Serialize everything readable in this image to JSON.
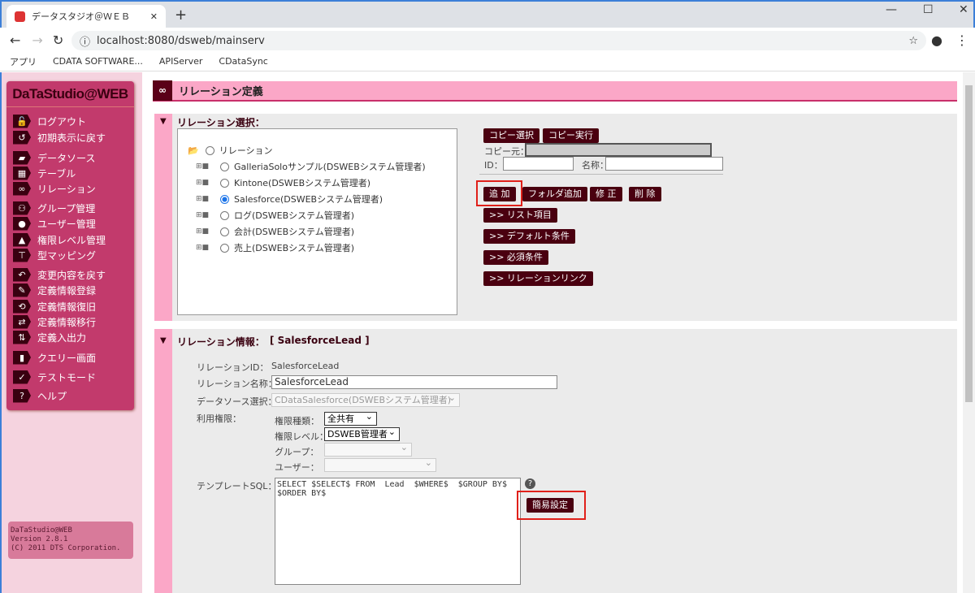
{
  "browser": {
    "tab_title": "データスタジオ＠ＷＥＢ",
    "url": "localhost:8080/dsweb/mainserv",
    "bookmarks": [
      "アプリ",
      "CDATA SOFTWARE...",
      "APIServer",
      "CDataSync"
    ]
  },
  "sidebar": {
    "logo": "DaTaStudio@WEB",
    "items": [
      {
        "label": "ログアウト",
        "icon": "lock-icon"
      },
      {
        "label": "初期表示に戻す",
        "icon": "reset-icon"
      },
      {
        "label": "データソース",
        "icon": "folder-open-icon"
      },
      {
        "label": "テーブル",
        "icon": "table-icon"
      },
      {
        "label": "リレーション",
        "icon": "link-icon"
      },
      {
        "label": "グループ管理",
        "icon": "group-icon"
      },
      {
        "label": "ユーザー管理",
        "icon": "user-icon"
      },
      {
        "label": "権限レベル管理",
        "icon": "pyramid-icon"
      },
      {
        "label": "型マッピング",
        "icon": "mapping-icon"
      },
      {
        "label": "変更内容を戻す",
        "icon": "undo-doc-icon"
      },
      {
        "label": "定義情報登録",
        "icon": "edit-doc-icon"
      },
      {
        "label": "定義情報復旧",
        "icon": "restore-doc-icon"
      },
      {
        "label": "定義情報移行",
        "icon": "migrate-doc-icon"
      },
      {
        "label": "定義入出力",
        "icon": "import-export-icon"
      },
      {
        "label": "クエリー画面",
        "icon": "chart-icon"
      },
      {
        "label": "テストモード",
        "icon": "check-icon"
      },
      {
        "label": "ヘルプ",
        "icon": "help-icon"
      }
    ],
    "version": [
      "DaTaStudio@WEB",
      "Version 2.8.1",
      "(C) 2011 DTS Corporation."
    ]
  },
  "header": {
    "title": "リレーション定義"
  },
  "select_section": {
    "title": "リレーション選択：",
    "root": "リレーション",
    "items": [
      "GalleriaSoloサンプル(DSWEBシステム管理者)",
      "Kintone(DSWEBシステム管理者)",
      "Salesforce(DSWEBシステム管理者)",
      "ログ(DSWEBシステム管理者)",
      "会計(DSWEBシステム管理者)",
      "売上(DSWEBシステム管理者)"
    ],
    "selected": 2,
    "copy_select": "コピー選択",
    "copy_exec": "コピー実行",
    "copy_src_label": "コピー元：",
    "id_label": "ID：",
    "name_label": "名称：",
    "add": "追 加",
    "add_folder": "フォルダ追加",
    "edit": "修 正",
    "delete": "削 除",
    "list_items": ">> リスト項目",
    "default_cond": ">> デフォルト条件",
    "required_cond": ">> 必須条件",
    "relation_link": ">> リレーションリンク"
  },
  "info_section": {
    "title": "リレーション情報：",
    "name_bracket": "[ SalesforceLead ]",
    "id_label": "リレーションID：",
    "id_value": "SalesforceLead",
    "name_label": "リレーション名称：",
    "name_value": "SalesforceLead",
    "ds_label": "データソース選択：",
    "ds_value": "CDataSalesforce(DSWEBシステム管理者)",
    "perm_label": "利用権限：",
    "perm_type_label": "権限種類：",
    "perm_type_value": "全共有",
    "perm_level_label": "権限レベル：",
    "perm_level_value": "DSWEB管理者",
    "group_label": "グループ：",
    "user_label": "ユーザー：",
    "sql_label": "テンプレートSQL：",
    "sql_value": "SELECT $SELECT$ FROM  Lead  $WHERE$  $GROUP BY$\n$ORDER BY$",
    "simple_setting": "簡易設定"
  }
}
